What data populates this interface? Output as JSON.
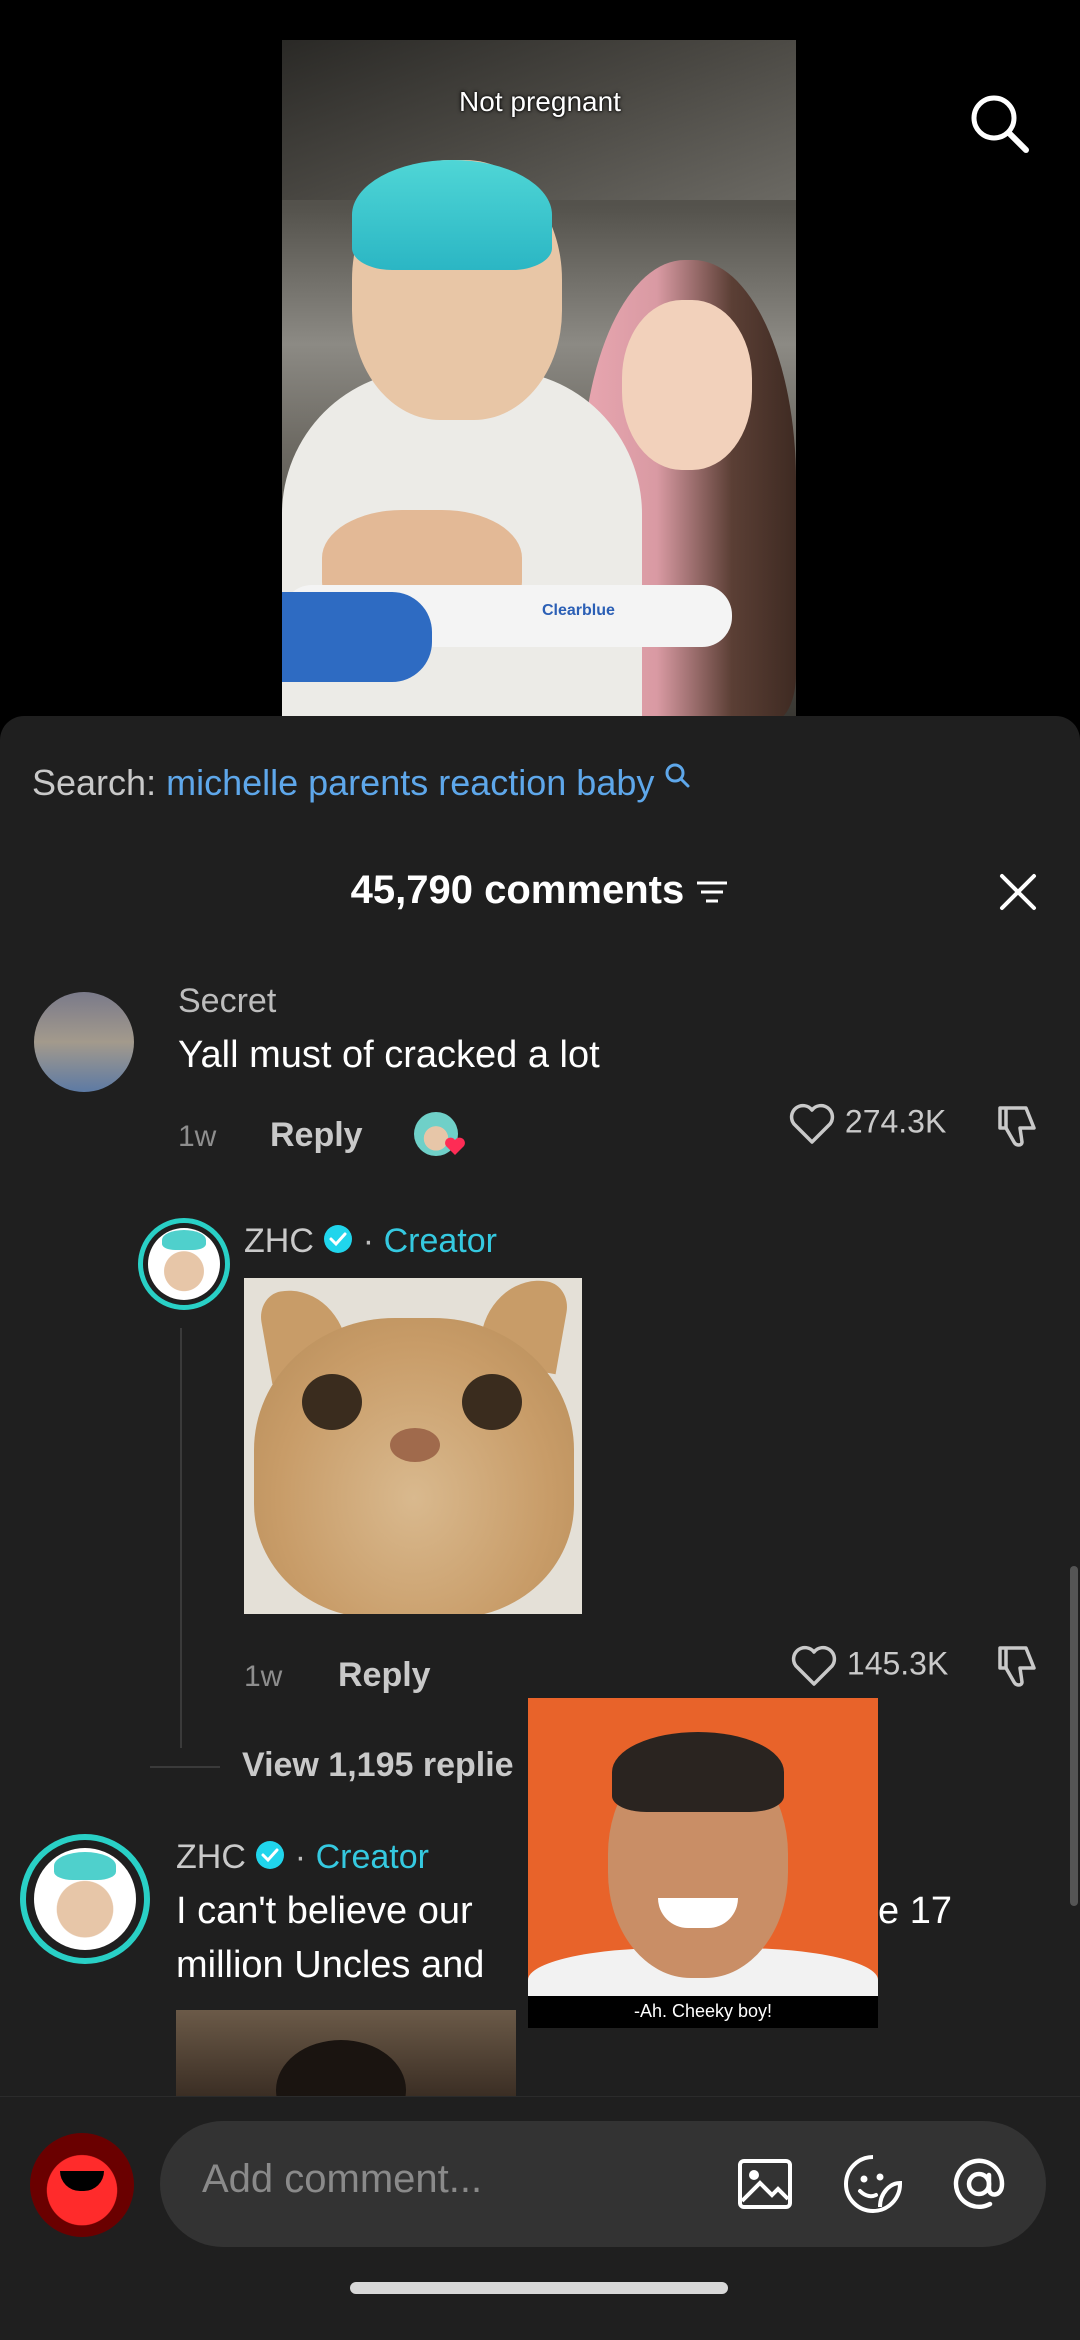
{
  "video": {
    "caption": "Not pregnant",
    "test_brand": "Clearblue"
  },
  "sheet": {
    "search_label": "Search:",
    "search_query": "michelle parents reaction baby",
    "comment_count": "45,790 comments"
  },
  "comments": [
    {
      "user": "Secret",
      "text": "Yall must of cracked a lot",
      "age": "1w",
      "reply_label": "Reply",
      "likes": "274.3K"
    }
  ],
  "reply": {
    "user": "ZHC",
    "separator": "·",
    "badge": "Creator",
    "age": "1w",
    "reply_label": "Reply",
    "likes": "145.3K"
  },
  "view_replies": "View 1,195 replie",
  "comment2": {
    "user": "ZHC",
    "separator": "·",
    "badge": "Creator",
    "text_line1_a": "I can't believe our",
    "text_line1_b": "e 17",
    "text_line2": "million Uncles and"
  },
  "pip": {
    "caption": "-Ah. Cheeky boy!"
  },
  "composer": {
    "placeholder": "Add comment..."
  },
  "colors": {
    "accent": "#35c9e0",
    "link": "#5ea7ea",
    "sheet_bg": "#1f1f1f"
  }
}
